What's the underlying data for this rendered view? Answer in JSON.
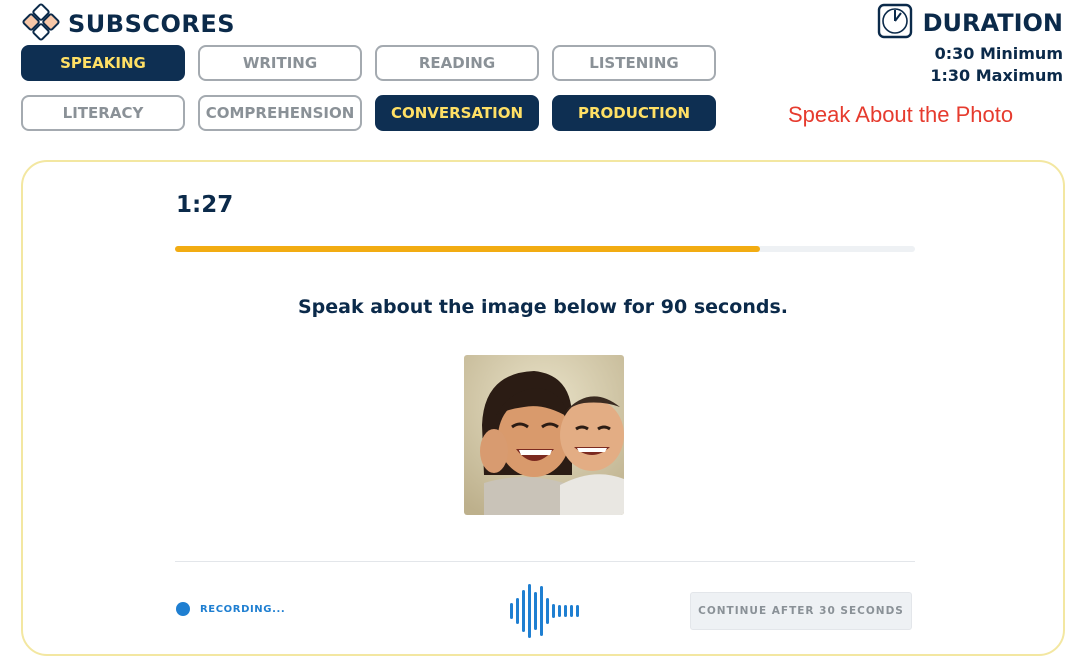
{
  "header": {
    "title": "SUBSCORES",
    "duration_title": "DURATION",
    "duration_min": "0:30 Minimum",
    "duration_max": "1:30 Maximum"
  },
  "subscores": [
    {
      "label": "SPEAKING",
      "active": true
    },
    {
      "label": "WRITING",
      "active": false
    },
    {
      "label": "READING",
      "active": false
    },
    {
      "label": "LISTENING",
      "active": false
    },
    {
      "label": "LITERACY",
      "active": false
    },
    {
      "label": "COMPREHENSION",
      "active": false
    },
    {
      "label": "CONVERSATION",
      "active": true
    },
    {
      "label": "PRODUCTION",
      "active": true
    }
  ],
  "annotation": "Speak About the Photo",
  "question": {
    "timer": "1:27",
    "progress": 0.79,
    "prompt": "Speak about the image below for 90 seconds.",
    "recording_label": "RECORDING...",
    "continue_label": "CONTINUE AFTER 30 SECONDS"
  },
  "colors": {
    "navy": "#0e2f52",
    "active_text": "#ffe065",
    "progress": "#f2ac12",
    "recording": "#1f7fd1",
    "annotation": "#e63b2e",
    "card_border": "#f3e7a1"
  },
  "icons": {
    "brand": "diamond-grid-icon",
    "duration": "clock-icon",
    "recording": "recording-dot-icon",
    "wave": "audio-wave-icon"
  }
}
